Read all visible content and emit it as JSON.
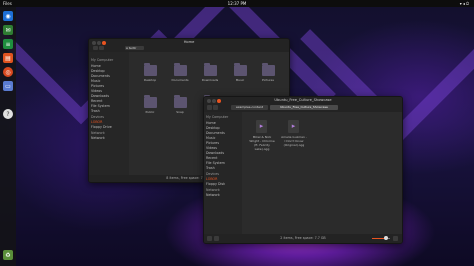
{
  "topbar": {
    "app": "Files",
    "clock": "12:37 PM"
  },
  "dock": {
    "items": [
      "firefox-icon",
      "thunderbird-icon",
      "libreoffice-writer-icon",
      "libreoffice-impress-icon",
      "ubuntu-software-icon",
      "files-icon",
      "help-icon",
      "trash-icon"
    ]
  },
  "back_window": {
    "title": "Home",
    "path": "ter6r",
    "sidebar": [
      "My Computer",
      "Home",
      "Desktop",
      "Documents",
      "Music",
      "Pictures",
      "Videos",
      "Downloads",
      "Recent",
      "File System",
      "Trash",
      "Devices",
      "LOBOR",
      "Floppy Drive",
      "Network",
      "Network"
    ],
    "files": [
      "Desktop",
      "Documents",
      "Downloads",
      "Music",
      "Pictures",
      "Public",
      "Snap",
      "Videos"
    ],
    "status": "8 items, Free space: 7.7 GB"
  },
  "front_window": {
    "title": "Ubuntu_Free_Culture_Showcase",
    "breadcrumb": [
      "examples-content",
      "Ubuntu_Free_Culture_Showcase"
    ],
    "sidebar": [
      "My Computer",
      "Home",
      "Desktop",
      "Documents",
      "Music",
      "Pictures",
      "Videos",
      "Downloads",
      "Recent",
      "File System",
      "Trash",
      "Devices",
      "LOBOR",
      "Floppy Disk",
      "Network",
      "Network"
    ],
    "files": [
      {
        "name": "Mikel & Nick Wright - Chlorine (ft. Felicity Lake).ogg"
      },
      {
        "name": "Amelia Guzman - I Don't Know (Original).ogg"
      }
    ],
    "status": "2 items, Free space: 7.7 GB"
  }
}
